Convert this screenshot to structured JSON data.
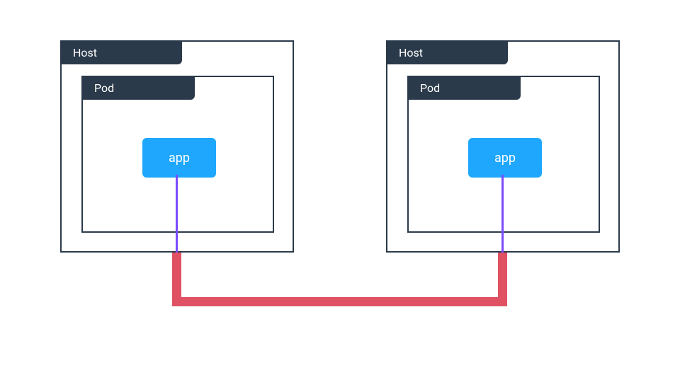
{
  "diagram": {
    "hosts": [
      {
        "label": "Host",
        "pod": {
          "label": "Pod",
          "app": {
            "label": "app"
          }
        }
      },
      {
        "label": "Host",
        "pod": {
          "label": "Pod",
          "app": {
            "label": "app"
          }
        }
      }
    ]
  },
  "colors": {
    "border": "#2b3a4a",
    "labelBg": "#2b3a4a",
    "labelText": "#ffffff",
    "app": "#1ea7fd",
    "connectorInner": "#7b4bff",
    "connectorOuter": "#e05263"
  }
}
